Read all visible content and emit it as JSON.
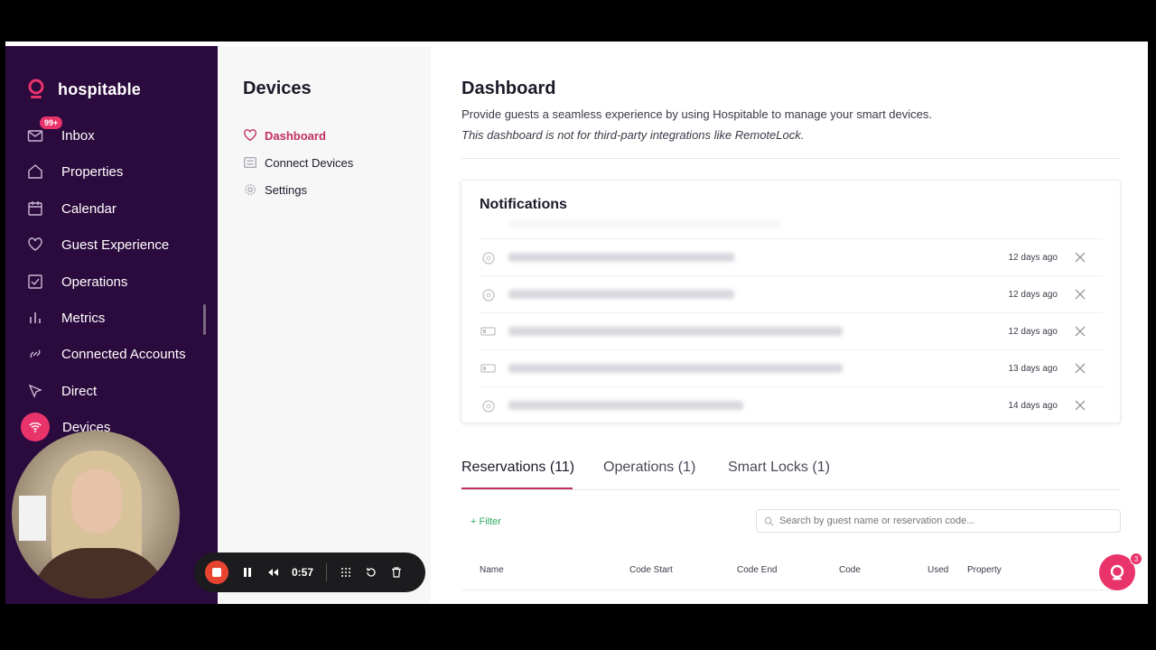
{
  "brand": {
    "name": "hospitable",
    "accent": "#e8336b"
  },
  "sidebar": {
    "items": [
      {
        "label": "Inbox",
        "icon": "mail-icon",
        "badge": "99+"
      },
      {
        "label": "Properties",
        "icon": "home-icon"
      },
      {
        "label": "Calendar",
        "icon": "calendar-icon"
      },
      {
        "label": "Guest Experience",
        "icon": "heart-icon"
      },
      {
        "label": "Operations",
        "icon": "checkbox-icon"
      },
      {
        "label": "Metrics",
        "icon": "bar-chart-icon"
      },
      {
        "label": "Connected Accounts",
        "icon": "link-icon"
      },
      {
        "label": "Direct",
        "icon": "cursor-icon"
      },
      {
        "label": "Devices",
        "icon": "wifi-icon",
        "active": true
      }
    ]
  },
  "subnav": {
    "title": "Devices",
    "items": [
      {
        "label": "Dashboard",
        "icon": "heart-icon",
        "active": true
      },
      {
        "label": "Connect Devices",
        "icon": "sliders-icon"
      },
      {
        "label": "Settings",
        "icon": "gear-icon"
      }
    ]
  },
  "main": {
    "title": "Dashboard",
    "description": "Provide guests a seamless experience by using Hospitable to manage your smart devices.",
    "note": "This dashboard is not for third-party integrations like RemoteLock.",
    "notifications": {
      "title": "Notifications",
      "rows": [
        {
          "ago": "12 days ago",
          "icon": "lock-icon"
        },
        {
          "ago": "12 days ago",
          "icon": "lock-icon"
        },
        {
          "ago": "12 days ago",
          "icon": "battery-icon"
        },
        {
          "ago": "13 days ago",
          "icon": "battery-icon"
        },
        {
          "ago": "14 days ago",
          "icon": "lock-icon"
        }
      ]
    },
    "tabs": [
      {
        "label": "Reservations (11)",
        "active": true
      },
      {
        "label": "Operations (1)"
      },
      {
        "label": "Smart Locks (1)"
      }
    ],
    "filter_label": "+ Filter",
    "search_placeholder": "Search by guest name or reservation code...",
    "table_headers": [
      "Name",
      "Code Start",
      "Code End",
      "Code",
      "Used",
      "Property"
    ]
  },
  "chat": {
    "count": "3"
  },
  "recorder": {
    "time": "0:57"
  }
}
